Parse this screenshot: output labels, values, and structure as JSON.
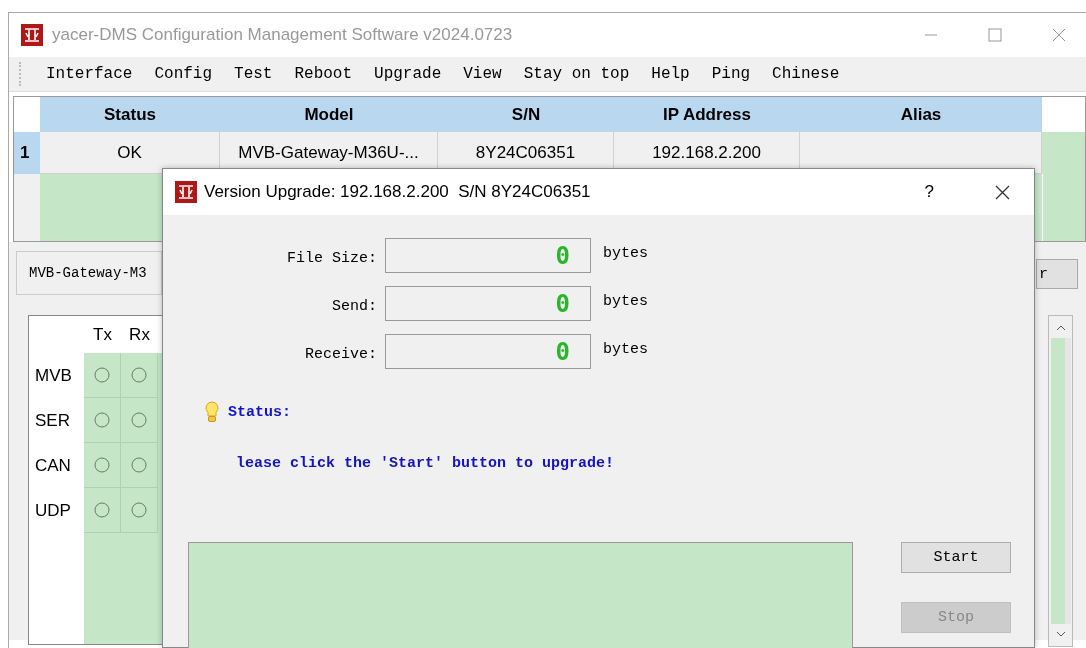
{
  "window": {
    "title": "yacer-DMS Configuration Management Software v2024.0723"
  },
  "menu": [
    "Interface",
    "Config",
    "Test",
    "Reboot",
    "Upgrade",
    "View",
    "Stay on top",
    "Help",
    "Ping",
    "Chinese"
  ],
  "device_table": {
    "columns": [
      "Status",
      "Model",
      "S/N",
      "IP Address",
      "Alias"
    ],
    "rows": [
      {
        "index": "1",
        "selected": true,
        "cells": [
          "OK",
          "MVB-Gateway-M36U-...",
          "8Y24C06351",
          "192.168.2.200"
        ]
      }
    ]
  },
  "device_tab": {
    "label": "MVB-Gateway-M3"
  },
  "partial_button": {
    "label": "r"
  },
  "port_table": {
    "columns": [
      "Tx",
      "Rx"
    ],
    "rows": [
      {
        "name": "MVB",
        "tx_on": false,
        "rx_on": false
      },
      {
        "name": "SER",
        "tx_on": false,
        "rx_on": false
      },
      {
        "name": "CAN",
        "tx_on": false,
        "rx_on": false
      },
      {
        "name": "UDP",
        "tx_on": false,
        "rx_on": false
      }
    ]
  },
  "dialog": {
    "title": "Version Upgrade: 192.168.2.200  S/N 8Y24C06351",
    "help": "?",
    "fields": [
      {
        "label": "File Size:",
        "value": "0",
        "unit": "bytes"
      },
      {
        "label": "Send:",
        "value": "0",
        "unit": "bytes"
      },
      {
        "label": "Receive:",
        "value": "0",
        "unit": "bytes"
      }
    ],
    "status_label": "Status:",
    "message": "lease click the 'Start' button to upgrade!",
    "buttons": [
      {
        "label": "Start",
        "disabled": false
      },
      {
        "label": "Stop",
        "disabled": true
      }
    ]
  }
}
